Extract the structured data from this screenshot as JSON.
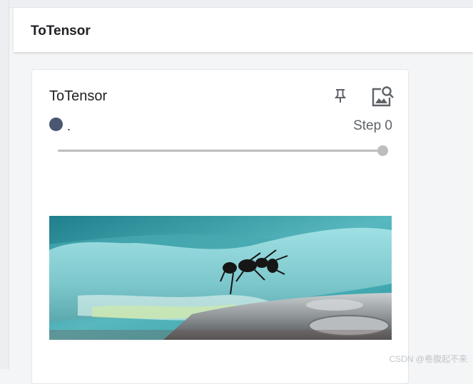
{
  "group": {
    "title": "ToTensor"
  },
  "card": {
    "title": "ToTensor",
    "run_label": ".",
    "step_text": "Step 0",
    "run_color": "#4a5672",
    "slider_value": 1.0
  },
  "icons": {
    "pin": "pin-icon",
    "image_search": "image-search-icon"
  },
  "image": {
    "subject": "ant on wet glass"
  },
  "watermark": "CSDN @卷腹起不来"
}
